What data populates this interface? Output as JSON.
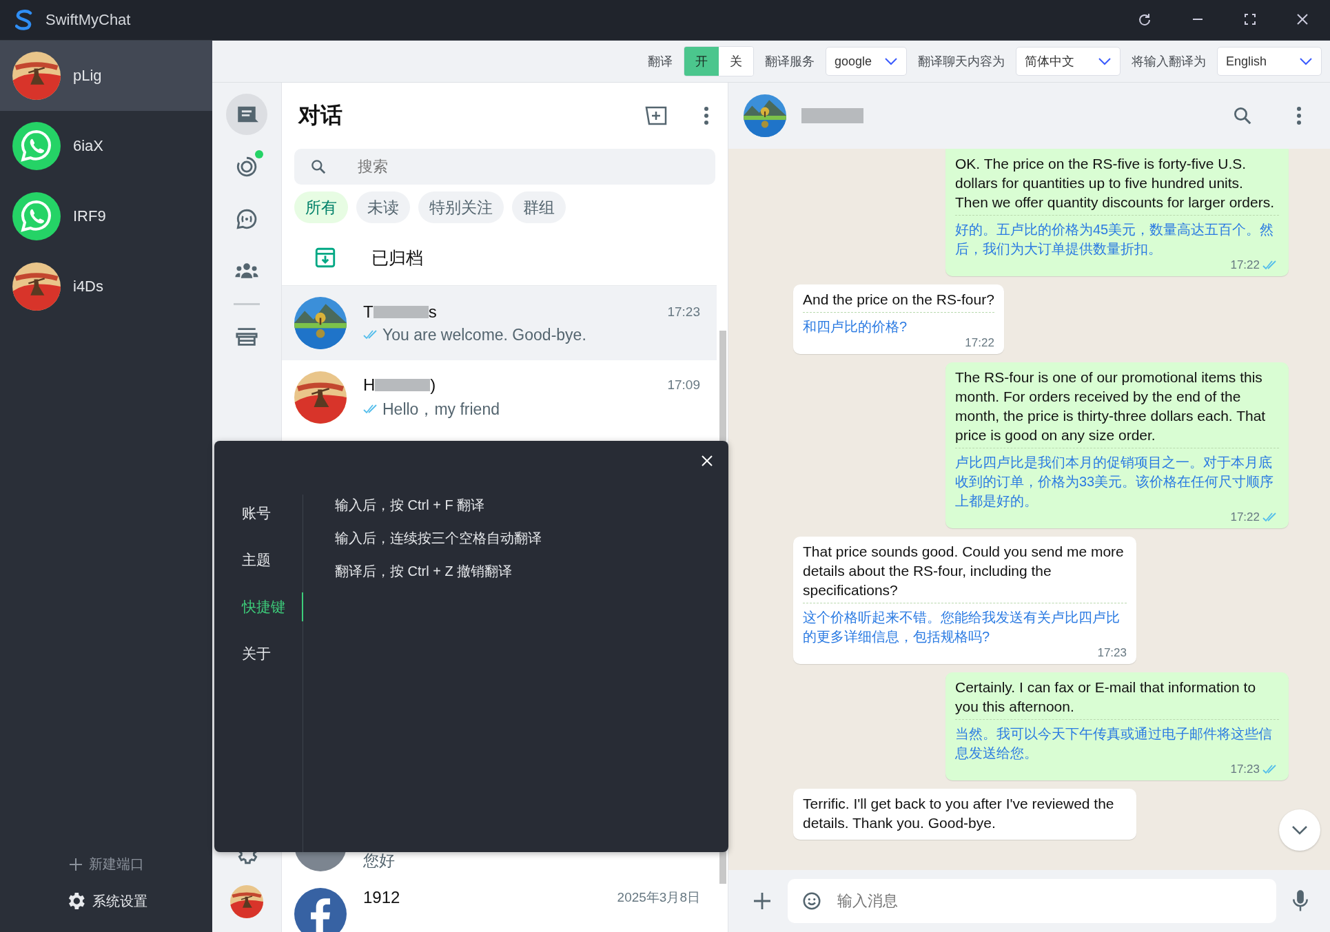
{
  "window": {
    "title": "SwiftMyChat"
  },
  "accounts": [
    {
      "name": "pLig",
      "avatar": {
        "kind": "art"
      },
      "selected": true
    },
    {
      "name": "6iaX",
      "avatar": {
        "kind": "whatsapp"
      },
      "selected": false
    },
    {
      "name": "IRF9",
      "avatar": {
        "kind": "whatsapp"
      },
      "selected": false
    },
    {
      "name": "i4Ds",
      "avatar": {
        "kind": "art"
      },
      "selected": false
    }
  ],
  "sidebar_footer": {
    "new_port": "新建端口",
    "settings": "系统设置"
  },
  "translate_bar": {
    "label": "翻译",
    "toggle": [
      {
        "label": "开",
        "selected": true
      },
      {
        "label": "关",
        "selected": false
      }
    ],
    "service_label": "翻译服务",
    "service": "google",
    "chat_label": "翻译聊天内容为",
    "chat_language": "简体中文",
    "input_label": "将输入翻译为",
    "input_language": "English"
  },
  "rail": [
    {
      "kind": "chats",
      "selected": true,
      "badge": false
    },
    {
      "kind": "status",
      "selected": false,
      "badge": true
    },
    {
      "kind": "channels",
      "selected": false,
      "badge": false
    },
    {
      "kind": "communities",
      "selected": false,
      "badge": false
    },
    {
      "kind": "store",
      "selected": false,
      "badge": false
    }
  ],
  "chat_list": {
    "title": "对话",
    "search": {
      "placeholder": "搜索"
    },
    "filters": [
      {
        "label": "所有",
        "selected": true
      },
      {
        "label": "未读",
        "selected": false
      },
      {
        "label": "特别关注",
        "selected": false
      },
      {
        "label": "群组",
        "selected": false
      }
    ],
    "archived": "已归档",
    "chats": [
      {
        "name_start": "T",
        "name_end": "s",
        "avatar": {
          "kind": "landscape"
        },
        "time": "17:23",
        "ticks": true,
        "message": "You are welcome. Good-bye.",
        "selected": true
      },
      {
        "name_start": "H",
        "name_end": ")",
        "avatar": {
          "kind": "art"
        },
        "time": "17:09",
        "ticks": true,
        "message": "Hello，my friend",
        "selected": false
      },
      {
        "avatar": {
          "kind": "photo"
        },
        "message": "您好",
        "ticks": false,
        "selected": false
      },
      {
        "name_start": "1912",
        "avatar": {
          "kind": "facebook"
        },
        "time": "2025年3月8日",
        "ticks": false,
        "selected": false
      }
    ]
  },
  "conversation": {
    "messages": [
      {
        "kind": "out",
        "text": "OK. The price on the RS-five is forty-five U.S. dollars for quantities up to five hundred units. Then we offer quantity discounts for larger orders.",
        "translation": "好的。五卢比的价格为45美元，数量高达五百个。然后，我们为大订单提供数量折扣。",
        "time": "17:22",
        "read": true
      },
      {
        "kind": "in",
        "text": "And the price on the RS-four?",
        "translation": "和四卢比的价格?",
        "time": "17:22"
      },
      {
        "kind": "out",
        "text": "The RS-four is one of our promotional items this month. For orders received by the end of the month, the price is thirty-three dollars each. That price is good on any size order.",
        "translation": "卢比四卢比是我们本月的促销项目之一。对于本月底收到的订单，价格为33美元。该价格在任何尺寸顺序上都是好的。",
        "time": "17:22",
        "read": true
      },
      {
        "kind": "in",
        "text": "That price sounds good. Could you send me more details about the RS-four, including the specifications?",
        "translation": "这个价格听起来不错。您能给我发送有关卢比四卢比的更多详细信息，包括规格吗?",
        "time": "17:23"
      },
      {
        "kind": "out",
        "text": "Certainly. I can fax or E-mail that information to you this afternoon.",
        "translation": "当然。我可以今天下午传真或通过电子邮件将这些信息发送给您。",
        "time": "17:23",
        "read": true
      },
      {
        "kind": "in",
        "text": "Terrific. I'll get back to you after I've reviewed the details. Thank you. Good-bye."
      }
    ],
    "input": {
      "placeholder": "输入消息"
    }
  },
  "settings_dialog": {
    "menu": [
      {
        "label": "账号",
        "selected": false
      },
      {
        "label": "主题",
        "selected": false
      },
      {
        "label": "快捷键",
        "selected": true
      },
      {
        "label": "关于",
        "selected": false
      }
    ],
    "shortcuts": [
      "输入后，按 Ctrl + F 翻译",
      "输入后，连续按三个空格自动翻译",
      "翻译后，按 Ctrl + Z 撤销翻译"
    ]
  }
}
